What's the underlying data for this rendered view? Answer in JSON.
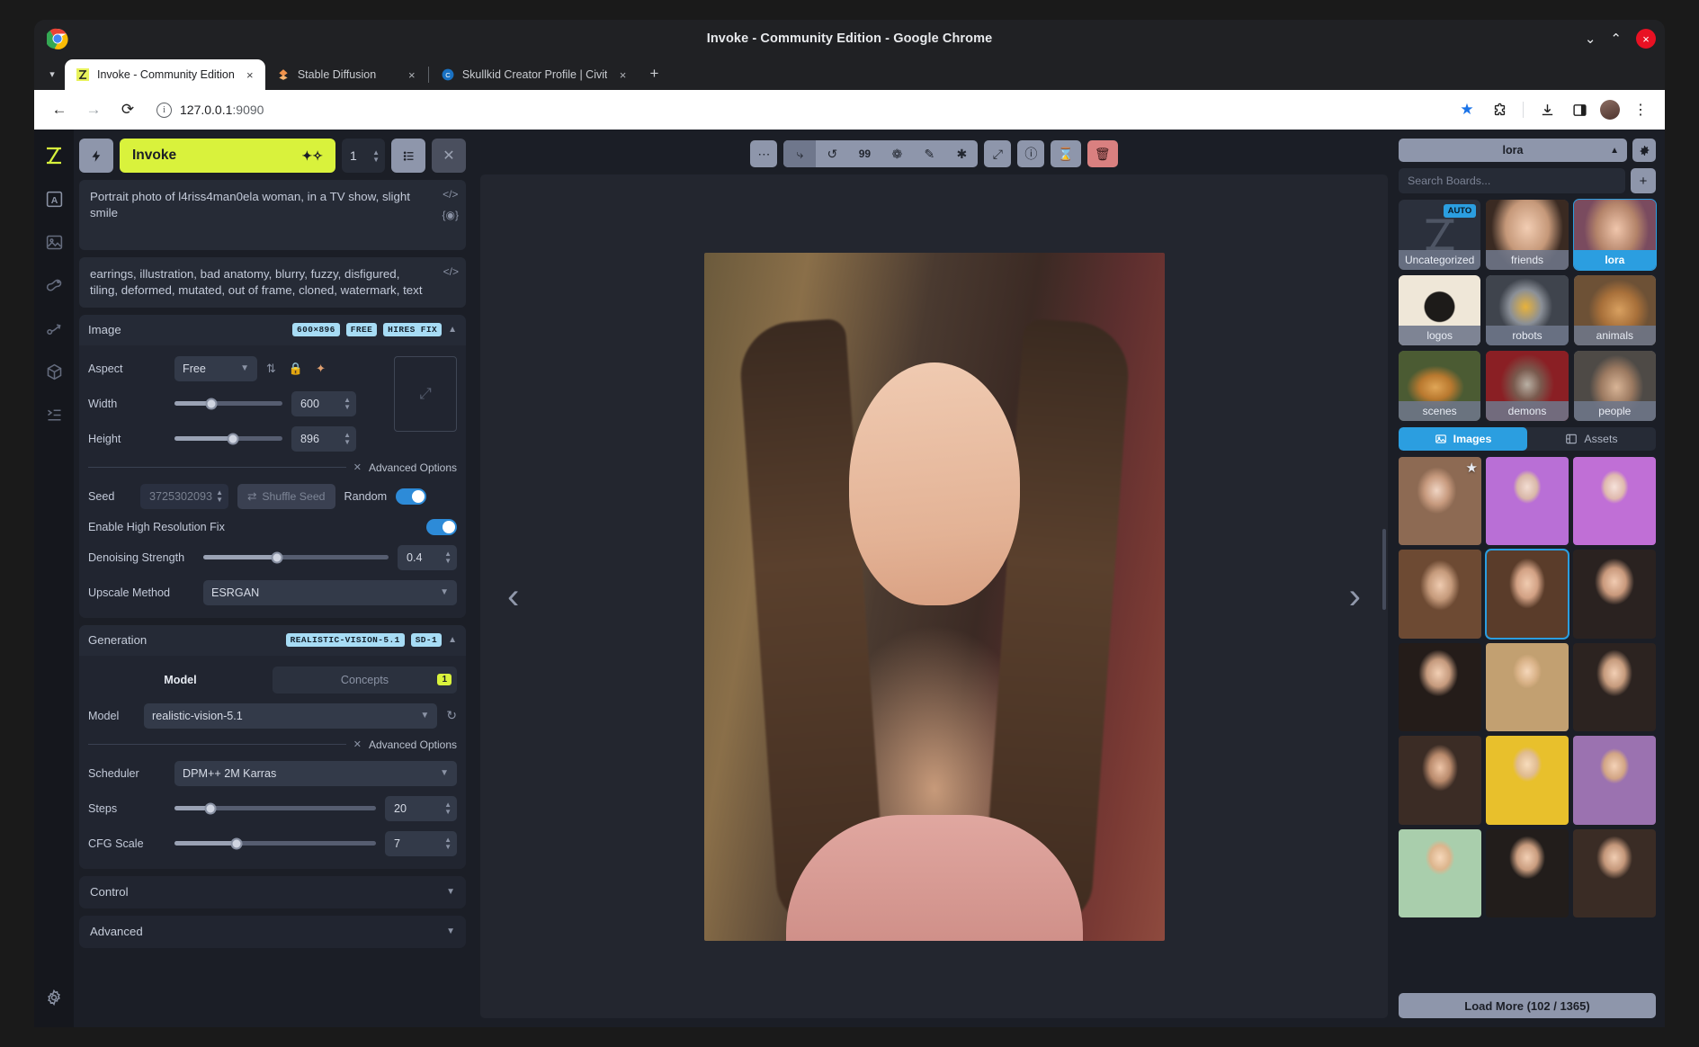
{
  "window": {
    "title": "Invoke - Community Edition - Google Chrome",
    "minimize": "⌄",
    "maximize": "⌃",
    "close": "×"
  },
  "browser": {
    "tab_list_icon": "chevron-down-icon",
    "tabs": [
      {
        "title": "Invoke - Community Edition",
        "favicon": "invoke-logo-icon",
        "close": "×",
        "active": true
      },
      {
        "title": "Stable Diffusion",
        "favicon": "stable-diffusion-icon",
        "close": "×",
        "active": false
      },
      {
        "title": "Skullkid Creator Profile | Civit",
        "favicon": "civitai-icon",
        "close": "×",
        "active": false
      }
    ],
    "new_tab": "+",
    "back": "←",
    "forward": "→",
    "reload": "⟳",
    "site_info": "i",
    "url_host": "127.0.0.1",
    "url_port": ":9090",
    "actions": [
      "bookmark-star-icon",
      "extensions-icon",
      "downloads-icon",
      "side-panel-icon",
      "profile-avatar",
      "chrome-menu-icon"
    ]
  },
  "rail": {
    "items": [
      {
        "name": "invoke-logo",
        "glyph": "⧉",
        "active": true
      },
      {
        "name": "text-to-image",
        "glyph": "A"
      },
      {
        "name": "image-to-image",
        "glyph": "Ὓc"
      },
      {
        "name": "unified-canvas",
        "glyph": "brush"
      },
      {
        "name": "nodes",
        "glyph": "node"
      },
      {
        "name": "model-manager",
        "glyph": "cube"
      },
      {
        "name": "queue",
        "glyph": "list"
      }
    ],
    "settings": "gear-icon"
  },
  "params": {
    "bolt_icon": "lightning-icon",
    "invoke_label": "Invoke",
    "invoke_sparkle": "sparkles-icon",
    "iterations": "1",
    "queue_icon": "queue-list-icon",
    "cancel_icon": "close-icon",
    "positive_prompt": "Portrait photo of l4riss4man0ela woman, in a TV show, slight smile",
    "negative_prompt": "earrings, illustration, bad anatomy, blurry, fuzzy, disfigured, tiling, deformed, mutated, out of frame, cloned, watermark, text",
    "prompt_tools": [
      "code-icon",
      "embedding-icon"
    ],
    "image_panel": {
      "title": "Image",
      "badges": [
        "600×896",
        "FREE",
        "HIRES FIX"
      ],
      "aspect_label": "Aspect",
      "aspect_value": "Free",
      "mini_icons": [
        "swap-dimensions-icon",
        "lock-aspect-icon",
        "auto-size-icon"
      ],
      "width_label": "Width",
      "width_value": "600",
      "height_label": "Height",
      "height_value": "896",
      "advanced_label": "Advanced Options",
      "seed_label": "Seed",
      "seed_value": "3725302093",
      "shuffle_label": "Shuffle Seed",
      "random_label": "Random",
      "random_on": true,
      "hires_label": "Enable High Resolution Fix",
      "hires_on": true,
      "denoise_label": "Denoising Strength",
      "denoise_value": "0.4",
      "upscale_label": "Upscale Method",
      "upscale_value": "ESRGAN"
    },
    "generation_panel": {
      "title": "Generation",
      "badges": [
        "REALISTIC-VISION-5.1",
        "SD-1"
      ],
      "tab_model": "Model",
      "tab_concepts": "Concepts",
      "concepts_count": "1",
      "model_label": "Model",
      "model_value": "realistic-vision-5.1",
      "refresh_icon": "refresh-icon",
      "advanced_label": "Advanced Options",
      "scheduler_label": "Scheduler",
      "scheduler_value": "DPM++ 2M Karras",
      "steps_label": "Steps",
      "steps_value": "20",
      "cfg_label": "CFG Scale",
      "cfg_value": "7"
    },
    "control_panel_title": "Control",
    "advanced_panel_title": "Advanced"
  },
  "canvas": {
    "toolbar": [
      {
        "name": "more-options-icon",
        "glyph": "⋯",
        "type": "button"
      },
      {
        "name": "use-prompt-icon",
        "glyph": "⤳",
        "type": "group",
        "selected": true
      },
      {
        "name": "use-seed-icon",
        "glyph": "↺",
        "type": "group"
      },
      {
        "name": "use-all-icon",
        "glyph": "99",
        "type": "group"
      },
      {
        "name": "use-initial-image-icon",
        "glyph": "❁",
        "type": "group"
      },
      {
        "name": "send-to-canvas-icon",
        "glyph": "✐",
        "type": "group"
      },
      {
        "name": "use-parameters-icon",
        "glyph": "✱",
        "type": "group"
      },
      {
        "name": "upscale-icon",
        "glyph": "⤢",
        "type": "button"
      },
      {
        "name": "metadata-info-icon",
        "glyph": "ⓘ",
        "type": "button"
      },
      {
        "name": "hourglass-icon",
        "glyph": "⧗",
        "type": "button"
      },
      {
        "name": "delete-image-icon",
        "glyph": "Ὕ1",
        "type": "danger"
      }
    ],
    "prev_arrow": "‹",
    "next_arrow": "›",
    "image_alt": "Portrait photo of a woman with long brown wavy hair in a pink top, TV show background"
  },
  "gallery": {
    "board_name": "lora",
    "board_chevron": "⌃",
    "board_settings_icon": "gear-icon",
    "search_placeholder": "Search Boards...",
    "add_board": "+",
    "boards": [
      {
        "label": "Uncategorized",
        "auto_tag": "AUTO",
        "selected": false,
        "thumb": "uncategorized-placeholder"
      },
      {
        "label": "friends",
        "selected": false,
        "thumb": "woman-smiling-dark-hair"
      },
      {
        "label": "lora",
        "selected": true,
        "thumb": "woman-glasses-smiling"
      },
      {
        "label": "logos",
        "selected": false,
        "thumb": "samurai-logo-ink"
      },
      {
        "label": "robots",
        "selected": false,
        "thumb": "yellow-robot-head"
      },
      {
        "label": "animals",
        "selected": false,
        "thumb": "lynx-cat"
      },
      {
        "label": "scenes",
        "selected": false,
        "thumb": "forest-mushrooms"
      },
      {
        "label": "demons",
        "selected": false,
        "thumb": "red-horned-demon"
      },
      {
        "label": "people",
        "selected": false,
        "thumb": "old-man-beanie"
      }
    ],
    "tabs": [
      {
        "label": "Images",
        "icon": "images-icon",
        "active": true
      },
      {
        "label": "Assets",
        "icon": "assets-icon",
        "active": false
      }
    ],
    "thumbs": [
      {
        "name": "woman-glasses-white-shirt",
        "starred": true,
        "selected": false,
        "c1": "#f0d5c4",
        "c2": "#8d6a53",
        "c3": "#dcdcdc"
      },
      {
        "name": "anime-purple-hair-garden",
        "starred": false,
        "selected": false,
        "c1": "#b96fd6",
        "c2": "#7fae6b",
        "c3": "#e6dfd2"
      },
      {
        "name": "anime-purple-hair-room",
        "starred": false,
        "selected": false,
        "c1": "#c06fd6",
        "c2": "#e6a0c8",
        "c3": "#efe6ec"
      },
      {
        "name": "woman-wavy-hair-red-top",
        "starred": false,
        "selected": false,
        "c1": "#e6c2a8",
        "c2": "#6d4a33",
        "c3": "#a8bcd1"
      },
      {
        "name": "woman-pink-top-tv-show",
        "starred": false,
        "selected": true,
        "c1": "#e8bfa5",
        "c2": "#5a3c2a",
        "c3": "#8d6038"
      },
      {
        "name": "woman-black-turtleneck-red-lips",
        "starred": false,
        "selected": false,
        "c1": "#e9c3a9",
        "c2": "#2a2220",
        "c3": "#6f7a82"
      },
      {
        "name": "woman-dark-hair-burgundy-lips",
        "starred": false,
        "selected": false,
        "c1": "#eec8ae",
        "c2": "#241c19",
        "c3": "#3a2e2a"
      },
      {
        "name": "woman-blonde-wavy-turtleneck",
        "starred": false,
        "selected": false,
        "c1": "#f0cfb4",
        "c2": "#c2a071",
        "c3": "#2b2421"
      },
      {
        "name": "woman-brunette-black-turtleneck",
        "starred": false,
        "selected": false,
        "c1": "#ecc7ad",
        "c2": "#2c2320",
        "c3": "#4a3b33"
      },
      {
        "name": "woman-white-turtleneck-makeup",
        "starred": false,
        "selected": false,
        "c1": "#e7bfa3",
        "c2": "#3b2c25",
        "c3": "#f2f0ee"
      },
      {
        "name": "woman-yellow-turtleneck-blonde",
        "starred": false,
        "selected": false,
        "c1": "#f2d3b5",
        "c2": "#e8c02c",
        "c3": "#6d553a"
      },
      {
        "name": "woman-purple-turtleneck",
        "starred": false,
        "selected": false,
        "c1": "#efcdb2",
        "c2": "#9b72b0",
        "c3": "#e9e4de"
      },
      {
        "name": "woman-green-top-smiling",
        "starred": false,
        "selected": false,
        "c1": "#f0d0b3",
        "c2": "#a9ceac",
        "c3": "#ded4c6"
      },
      {
        "name": "woman-black-top-long-hair",
        "starred": false,
        "selected": false,
        "c1": "#ecc9ae",
        "c2": "#221d1b",
        "c3": "#b7a18d"
      },
      {
        "name": "woman-brown-hair-black-top",
        "starred": false,
        "selected": false,
        "c1": "#eac6ab",
        "c2": "#3a2c25",
        "c3": "#8c7462"
      }
    ],
    "load_more": "Load More (102 / 1365)"
  },
  "colors": {
    "accent_yellow": "#d9f23c",
    "accent_blue": "#2b9ee0",
    "badge_blue": "#a7dcf5",
    "panel_bg": "#212530",
    "app_bg": "#1b1e26"
  }
}
